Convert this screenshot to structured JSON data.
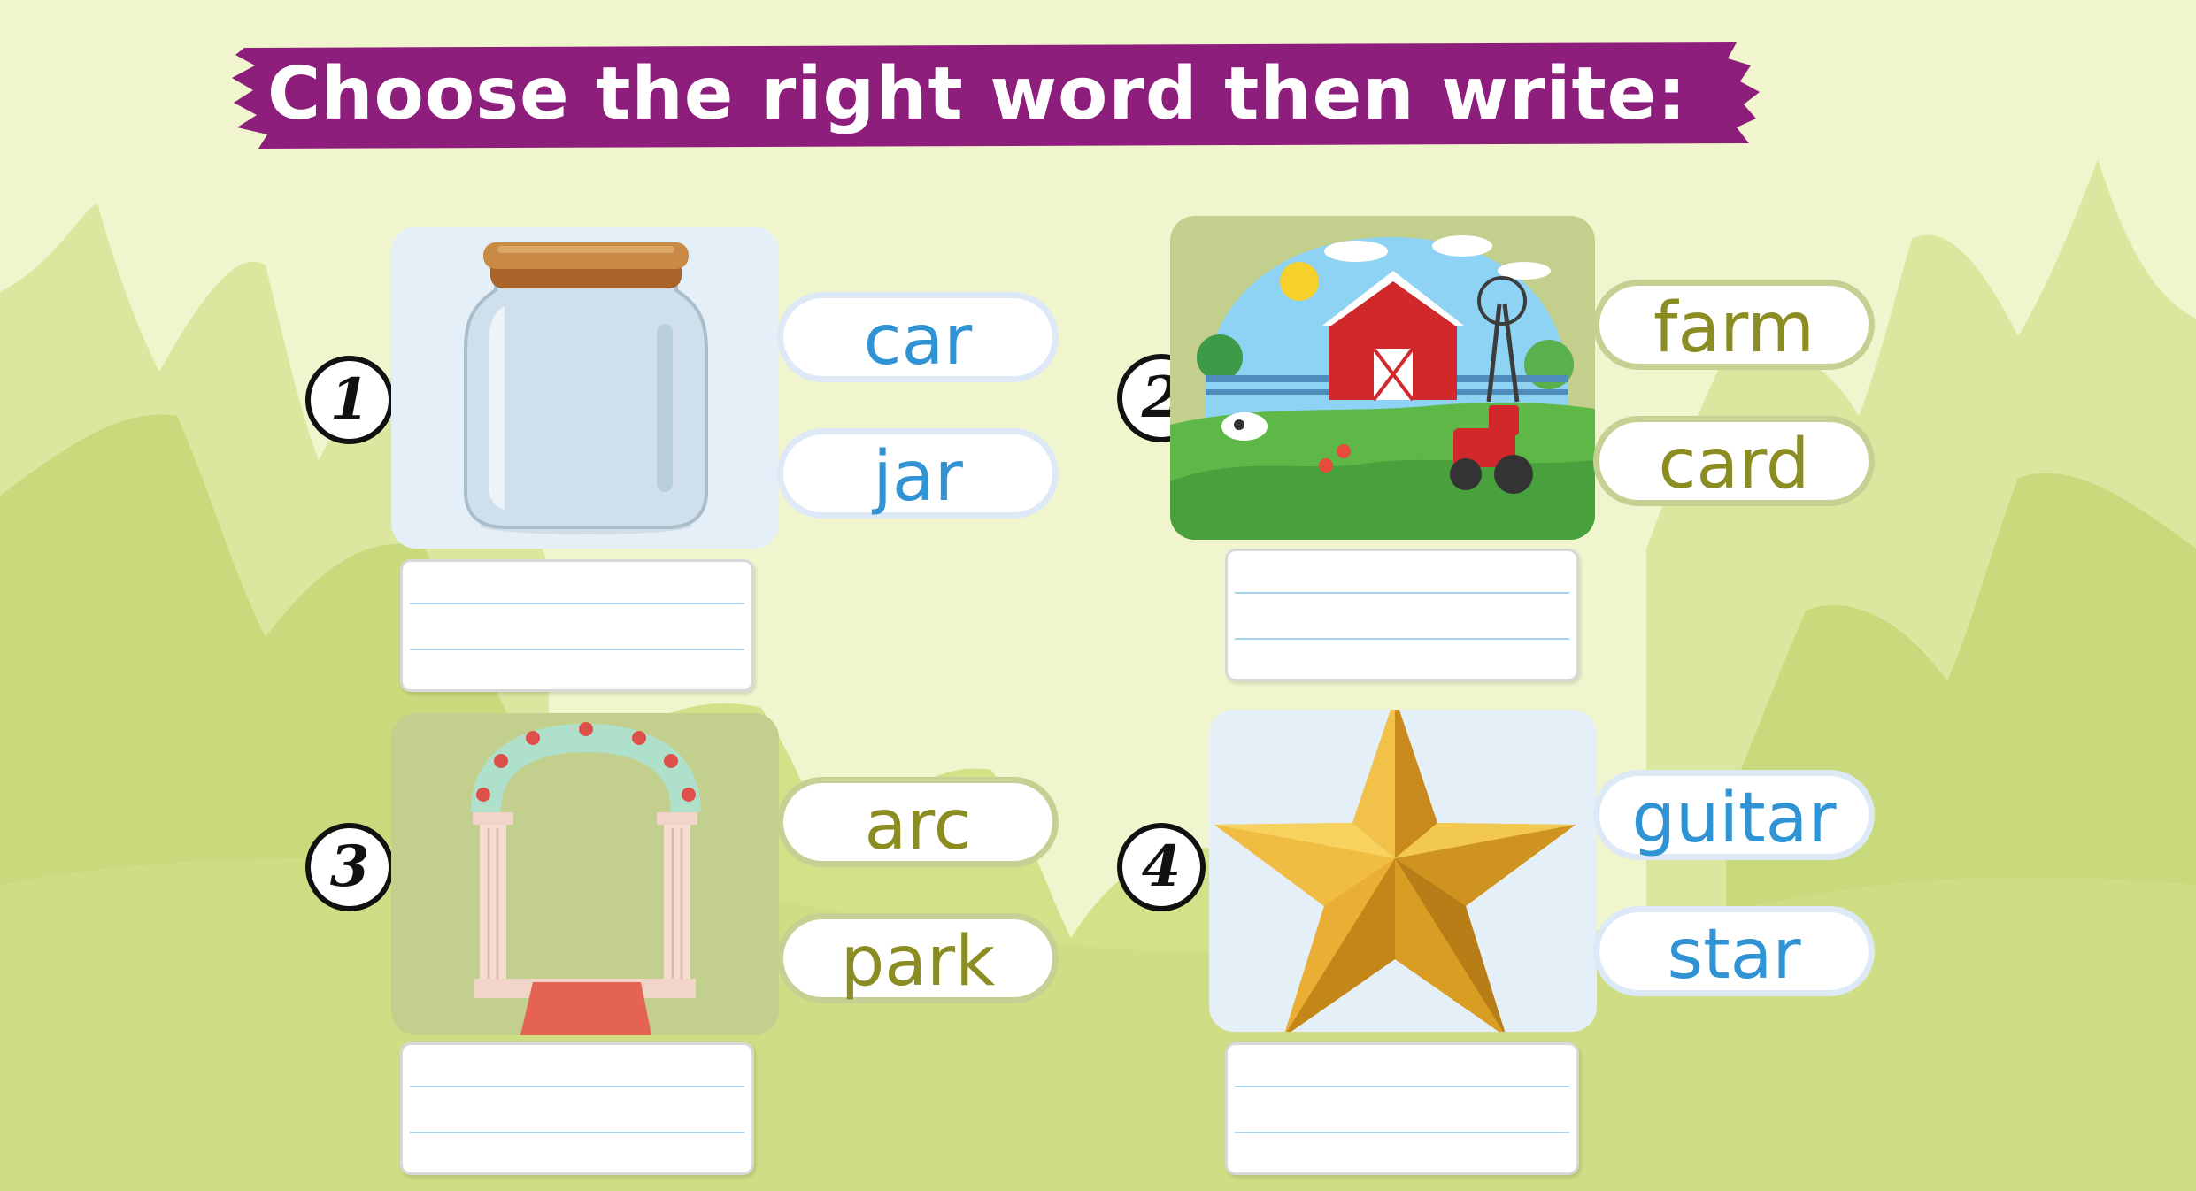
{
  "title": "Choose the right word then write:",
  "colors": {
    "banner": "#8e1e7c",
    "background": "#eef3c6",
    "grass": "#c9da7d",
    "blue_word": "#2f93d4",
    "olive_word": "#8b8d22"
  },
  "exercises": [
    {
      "number": "1",
      "picture": "jar-icon",
      "options": [
        "car",
        "jar"
      ],
      "answer_value": ""
    },
    {
      "number": "2",
      "picture": "farm-icon",
      "options": [
        "farm",
        "card"
      ],
      "answer_value": ""
    },
    {
      "number": "3",
      "picture": "arch-icon",
      "options": [
        "arc",
        "park"
      ],
      "answer_value": ""
    },
    {
      "number": "4",
      "picture": "star-icon",
      "options": [
        "guitar",
        "star"
      ],
      "answer_value": ""
    }
  ]
}
